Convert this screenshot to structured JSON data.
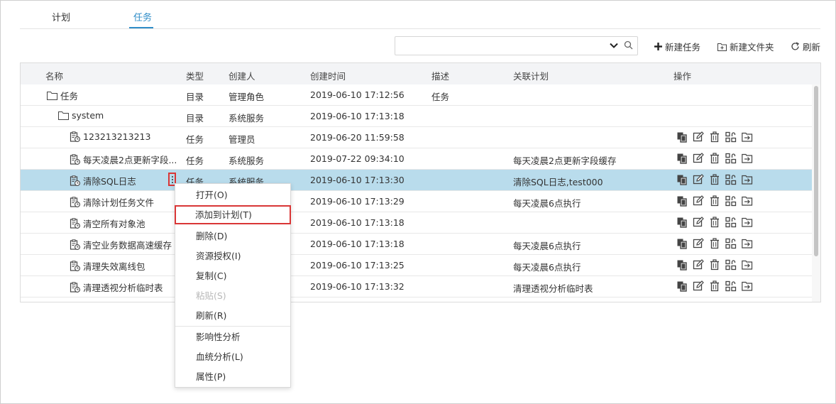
{
  "tabs": [
    {
      "label": "计划",
      "active": false
    },
    {
      "label": "任务",
      "active": true
    }
  ],
  "toolbar": {
    "search_value": "",
    "new_task": "新建任务",
    "new_folder": "新建文件夹",
    "refresh": "刷新"
  },
  "columns": [
    "名称",
    "类型",
    "创建人",
    "创建时间",
    "描述",
    "关联计划",
    "操作"
  ],
  "rows": [
    {
      "name": "任务",
      "icon": "folder-icon",
      "type": "目录",
      "creator": "管理角色",
      "created": "2019-06-10 17:12:56",
      "desc": "任务",
      "plan": "",
      "ops": false,
      "selected": false
    },
    {
      "name": "system",
      "icon": "folder-icon",
      "type": "目录",
      "creator": "系统服务",
      "created": "2019-06-10 17:13:18",
      "desc": "",
      "plan": "",
      "ops": false,
      "selected": false
    },
    {
      "name": "123213213213",
      "icon": "task-icon",
      "type": "任务",
      "creator": "管理员",
      "created": "2019-06-20 11:59:58",
      "desc": "",
      "plan": "",
      "ops": true,
      "selected": false
    },
    {
      "name": "每天凌晨2点更新字段...",
      "icon": "task-icon",
      "type": "任务",
      "creator": "系统服务",
      "created": "2019-07-22 09:34:10",
      "desc": "",
      "plan": "每天凌晨2点更新字段缓存",
      "ops": true,
      "selected": false
    },
    {
      "name": "清除SQL日志",
      "icon": "task-icon",
      "type": "任务",
      "creator": "系统服务",
      "created": "2019-06-10 17:13:30",
      "desc": "",
      "plan": "清除SQL日志,test000",
      "ops": true,
      "selected": true
    },
    {
      "name": "清除计划任务文件",
      "icon": "task-icon",
      "type": "",
      "creator": "",
      "created": "2019-06-10 17:13:29",
      "desc": "",
      "plan": "每天凌晨6点执行",
      "ops": true,
      "selected": false
    },
    {
      "name": "清空所有对象池",
      "icon": "task-icon",
      "type": "",
      "creator": "",
      "created": "2019-06-10 17:13:18",
      "desc": "",
      "plan": "",
      "ops": true,
      "selected": false
    },
    {
      "name": "清空业务数据高速缓存",
      "icon": "task-icon",
      "type": "",
      "creator": "",
      "created": "2019-06-10 17:13:18",
      "desc": "",
      "plan": "每天凌晨6点执行",
      "ops": true,
      "selected": false
    },
    {
      "name": "清理失效离线包",
      "icon": "task-icon",
      "type": "",
      "creator": "",
      "created": "2019-06-10 17:13:25",
      "desc": "",
      "plan": "每天凌晨6点执行",
      "ops": true,
      "selected": false
    },
    {
      "name": "清理透视分析临时表",
      "icon": "task-icon",
      "type": "",
      "creator": "",
      "created": "2019-06-10 17:13:32",
      "desc": "",
      "plan": "清理透视分析临时表",
      "ops": true,
      "selected": false
    }
  ],
  "context_menu": [
    {
      "label": "打开(O)",
      "disabled": false,
      "highlight": false
    },
    {
      "label": "添加到计划(T)",
      "disabled": false,
      "highlight": true
    },
    {
      "label": "删除(D)",
      "disabled": false,
      "highlight": false
    },
    {
      "label": "资源授权(I)",
      "disabled": false,
      "highlight": false
    },
    {
      "label": "复制(C)",
      "disabled": false,
      "highlight": false
    },
    {
      "label": "粘贴(S)",
      "disabled": true,
      "highlight": false
    },
    {
      "label": "刷新(R)",
      "disabled": false,
      "highlight": false
    },
    {
      "label": "影响性分析",
      "disabled": false,
      "highlight": false
    },
    {
      "label": "血统分析(L)",
      "disabled": false,
      "highlight": false
    },
    {
      "label": "属性(P)",
      "disabled": false,
      "highlight": false
    }
  ],
  "colors": {
    "accent": "#2f8dc8",
    "selected_row": "#b9dcec",
    "highlight_border": "#d93636"
  }
}
